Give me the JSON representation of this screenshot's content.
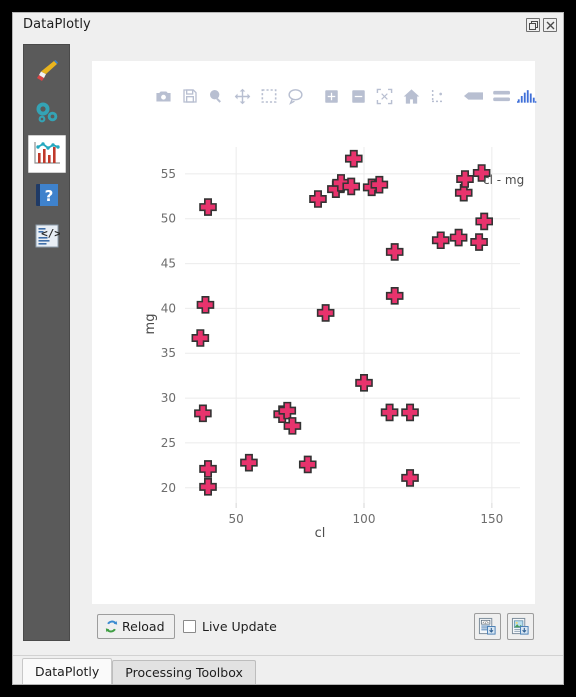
{
  "window": {
    "title": "DataPlotly",
    "buttons": [
      {
        "name": "undock-button",
        "icon": "undock-icon"
      },
      {
        "name": "close-button",
        "icon": "close-icon"
      }
    ]
  },
  "sidebar": {
    "items": [
      {
        "name": "sidebar-item-plot-type",
        "icon": "paintbrush-icon",
        "active": false
      },
      {
        "name": "sidebar-item-settings",
        "icon": "gears-icon",
        "active": false
      },
      {
        "name": "sidebar-item-plot-view",
        "icon": "chart-icon",
        "active": true
      },
      {
        "name": "sidebar-item-help",
        "icon": "help-book-icon",
        "active": false
      },
      {
        "name": "sidebar-item-code",
        "icon": "code-icon",
        "active": false
      }
    ]
  },
  "modebar": {
    "buttons": [
      {
        "name": "download-plot-button",
        "icon": "camera-icon"
      },
      {
        "name": "save-plot-button",
        "icon": "floppy-disk-icon"
      },
      {
        "name": "zoom-button",
        "icon": "magnifier-icon"
      },
      {
        "name": "pan-button",
        "icon": "move-arrows-icon"
      },
      {
        "name": "box-select-button",
        "icon": "dashed-box-icon"
      },
      {
        "name": "lasso-select-button",
        "icon": "lasso-icon"
      },
      {
        "name": "zoom-in-button",
        "icon": "plus-box-icon"
      },
      {
        "name": "zoom-out-button",
        "icon": "minus-box-icon"
      },
      {
        "name": "autoscale-button",
        "icon": "autoscale-icon"
      },
      {
        "name": "reset-axes-button",
        "icon": "home-icon"
      },
      {
        "name": "toggle-spike-lines-button",
        "icon": "spike-lines-icon"
      },
      {
        "name": "hover-closest-button",
        "icon": "hover-closest-icon"
      },
      {
        "name": "hover-compare-button",
        "icon": "hover-compare-icon"
      },
      {
        "name": "plotly-logo",
        "icon": "plotly-bars-icon"
      }
    ]
  },
  "footer": {
    "reload_label": "Reload",
    "reload_icon": "refresh-arrows-icon",
    "live_update_label": "Live Update",
    "live_update_checked": false,
    "export_buttons": [
      {
        "name": "save-as-html-button",
        "icon": "document-code-icon"
      },
      {
        "name": "save-as-image-button",
        "icon": "document-image-icon"
      }
    ]
  },
  "tabs": [
    {
      "label": "DataPlotly",
      "active": true
    },
    {
      "label": "Processing Toolbox",
      "active": false
    }
  ],
  "colors": {
    "marker_fill": "#e8336d",
    "marker_line": "#333333",
    "grid": "#ebebeb",
    "plot_bg": "#ffffff",
    "panel_bg": "#efefef",
    "modebar_icon": "#b8bfd1"
  },
  "chart_data": {
    "type": "scatter",
    "title": "",
    "xlabel": "cl",
    "ylabel": "mg",
    "xticks": [
      50,
      100,
      150
    ],
    "yticks": [
      20,
      25,
      30,
      35,
      40,
      45,
      50,
      55
    ],
    "xlim": [
      30,
      161
    ],
    "ylim": [
      18.3,
      58.0
    ],
    "grid": true,
    "legend_position": "right",
    "marker_symbol": "cross",
    "series": [
      {
        "name": "cl - mg",
        "points": [
          [
            39,
            51.3
          ],
          [
            38,
            40.4
          ],
          [
            36,
            36.7
          ],
          [
            37,
            28.3
          ],
          [
            39,
            22.1
          ],
          [
            39,
            20.1
          ],
          [
            55,
            22.8
          ],
          [
            68,
            28.2
          ],
          [
            70,
            28.6
          ],
          [
            72,
            26.9
          ],
          [
            78,
            22.6
          ],
          [
            82,
            52.2
          ],
          [
            85,
            39.5
          ],
          [
            89,
            53.3
          ],
          [
            91,
            54.0
          ],
          [
            95,
            53.6
          ],
          [
            96,
            56.7
          ],
          [
            100,
            31.7
          ],
          [
            103,
            53.5
          ],
          [
            106,
            53.8
          ],
          [
            110,
            28.4
          ],
          [
            112,
            41.4
          ],
          [
            112,
            46.3
          ],
          [
            118,
            28.4
          ],
          [
            118,
            21.1
          ],
          [
            130,
            47.6
          ],
          [
            137,
            47.9
          ],
          [
            139,
            52.9
          ],
          [
            145,
            47.4
          ],
          [
            147,
            49.7
          ],
          [
            146,
            55.1
          ]
        ]
      }
    ]
  }
}
